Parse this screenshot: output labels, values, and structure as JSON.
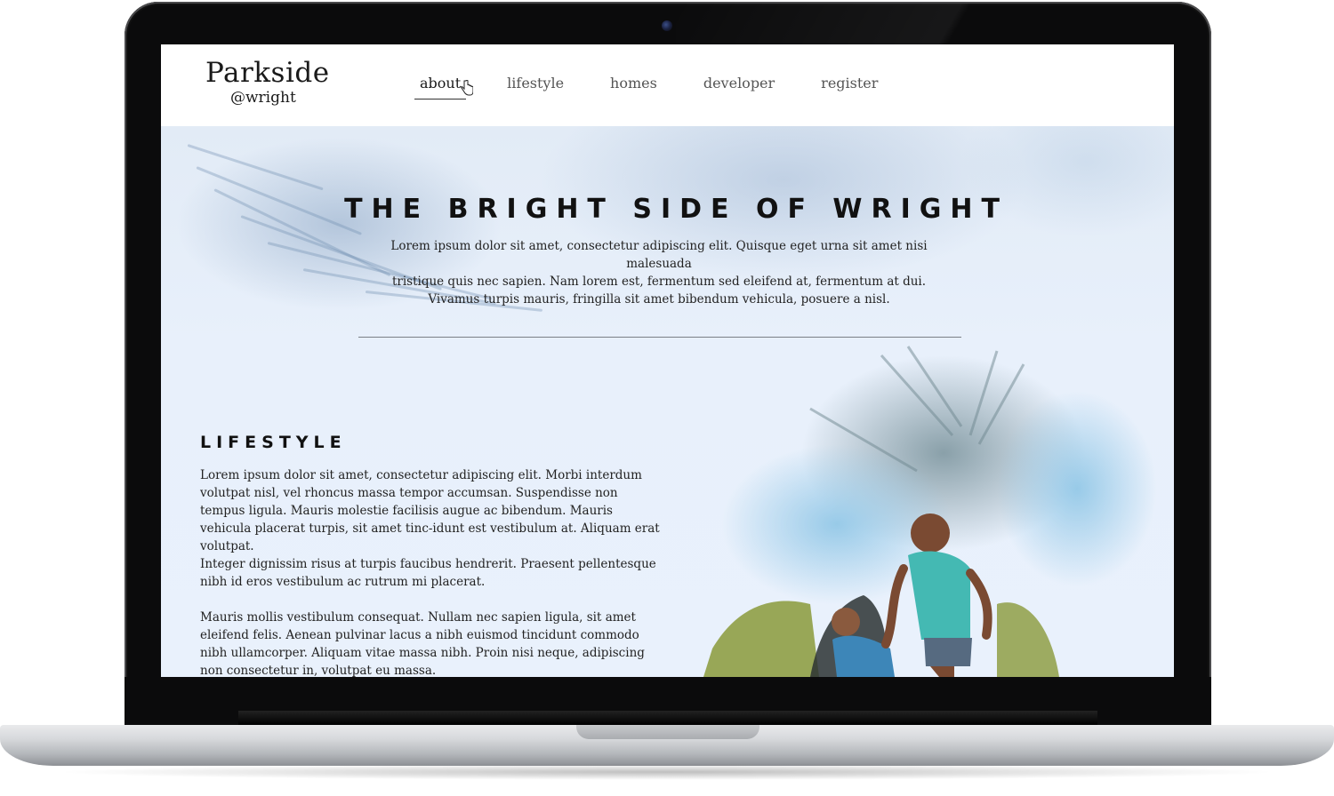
{
  "site": {
    "logo_title": "Parkside",
    "logo_sub": "@wright",
    "nav": [
      {
        "label": "about",
        "active": true
      },
      {
        "label": "lifestyle",
        "active": false
      },
      {
        "label": "homes",
        "active": false
      },
      {
        "label": "developer",
        "active": false
      },
      {
        "label": "register",
        "active": false
      }
    ],
    "hero": {
      "title": "THE BRIGHT SIDE OF WRIGHT",
      "text_lines": [
        "Lorem ipsum dolor sit amet, consectetur adipiscing elit. Quisque eget urna sit amet nisi malesuada",
        "tristique quis nec sapien. Nam lorem est, fermentum sed eleifend at, fermentum at dui.",
        "Vivamus turpis mauris, fringilla sit amet bibendum vehicula, posuere a nisl."
      ]
    },
    "lifestyle": {
      "title": "LIFESTYLE",
      "paragraphs": [
        " Lorem ipsum dolor sit amet, consectetur adipiscing elit. Morbi interdum volutpat nisl, vel rhoncus massa tempor accumsan. Suspendisse non tempus ligula. Mauris molestie facilisis augue ac bibendum. Mauris vehicula placerat turpis, sit amet tinc-idunt est vestibulum at. Aliquam erat volutpat.",
        "Integer dignissim risus at turpis faucibus hendrerit. Praesent pellentesque nibh id eros vestibulum ac rutrum mi placerat.",
        "Mauris mollis vestibulum consequat. Nullam nec sapien ligula, sit amet eleifend felis. Aenean pulvinar lacus a nibh euismod tincidunt commodo nibh ullamcorper. Aliquam vitae massa nibh. Proin nisi neque, adipiscing non consectetur in, volutpat eu massa."
      ]
    },
    "icons": {
      "cursor": "hand-pointer-icon",
      "camera": "webcam-icon"
    },
    "colors": {
      "page_bg": "#e8f0fb",
      "header_bg": "#ffffff",
      "text": "#1a1a1a",
      "accent_green": "#8a9a3a",
      "accent_teal": "#4fc4c4"
    }
  }
}
